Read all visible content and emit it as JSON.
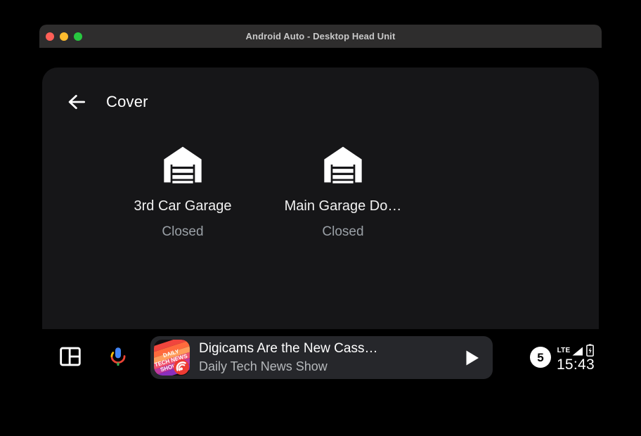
{
  "window": {
    "title": "Android Auto - Desktop Head Unit",
    "controls": {
      "close_label": "",
      "minimize_label": "",
      "maximize_label": ""
    }
  },
  "app": {
    "page_title": "Cover",
    "back_icon": "arrow-left-icon",
    "tiles": [
      {
        "icon": "garage-door-icon",
        "label": "3rd Car Garage",
        "status": "Closed"
      },
      {
        "icon": "garage-door-icon",
        "label": "Main Garage Do…",
        "status": "Closed"
      }
    ]
  },
  "nav_bar": {
    "apps_icon": "apps-grid-icon",
    "mic_icon": "assistant-mic-icon",
    "media": {
      "album_art_icon": "album-art-daily-tech-news-show",
      "album_art_text": "DAILY TECH NEWS SHOW",
      "title": "Digicams Are the New Cass…",
      "subtitle": "Daily Tech News Show",
      "play_icon": "play-icon"
    },
    "status": {
      "notification_count": "5",
      "network_type": "LTE",
      "signal_icon": "signal-bars-icon",
      "battery_icon": "battery-charging-icon",
      "time": "15:43"
    }
  },
  "colors": {
    "titlebar": "#2e2d2d",
    "panel": "#161618",
    "media_card": "#26272b",
    "accent_white": "#ffffff",
    "muted_text": "#9aa0a6",
    "traffic_close": "#ff5f57",
    "traffic_min": "#febc2e",
    "traffic_max": "#28c840"
  }
}
